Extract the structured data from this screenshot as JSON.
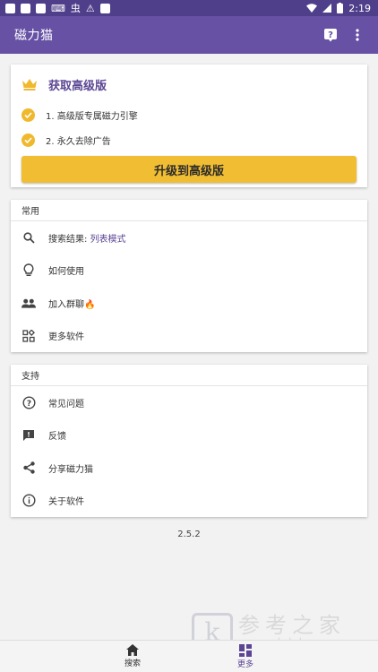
{
  "statusbar": {
    "time": "2:19",
    "left_glyphs": [
      "⌨",
      "虫",
      "⚠"
    ]
  },
  "appbar": {
    "title": "磁力猫"
  },
  "premium": {
    "title": "获取高级版",
    "features": [
      "1. 高级版专属磁力引擎",
      "2. 永久去除广告"
    ],
    "upgrade_label": "升级到高级版"
  },
  "common": {
    "header": "常用",
    "items": [
      {
        "label": "搜索结果: ",
        "value": "列表模式",
        "icon": "search-icon"
      },
      {
        "label": "如何使用",
        "icon": "lightbulb-icon"
      },
      {
        "label": "加入群聊",
        "badge": "🔥",
        "icon": "group-icon"
      },
      {
        "label": "更多软件",
        "icon": "apps-icon"
      }
    ]
  },
  "support": {
    "header": "支持",
    "items": [
      {
        "label": "常见问题",
        "icon": "help-circle-icon"
      },
      {
        "label": "反馈",
        "icon": "feedback-icon"
      },
      {
        "label": "分享磁力猫",
        "icon": "share-icon"
      },
      {
        "label": "关于软件",
        "icon": "info-icon"
      }
    ]
  },
  "version": "2.5.2",
  "bottomnav": {
    "items": [
      {
        "label": "搜索",
        "icon": "home-icon",
        "active": false
      },
      {
        "label": "更多",
        "icon": "dashboard-icon",
        "active": true
      }
    ]
  },
  "colors": {
    "primary": "#6651a5",
    "statusbar": "#4f3f8a",
    "accent": "#5b4694",
    "gold": "#f1bd32"
  },
  "watermark": {
    "text": "参考之家",
    "url": "www.ckdzb.com"
  }
}
